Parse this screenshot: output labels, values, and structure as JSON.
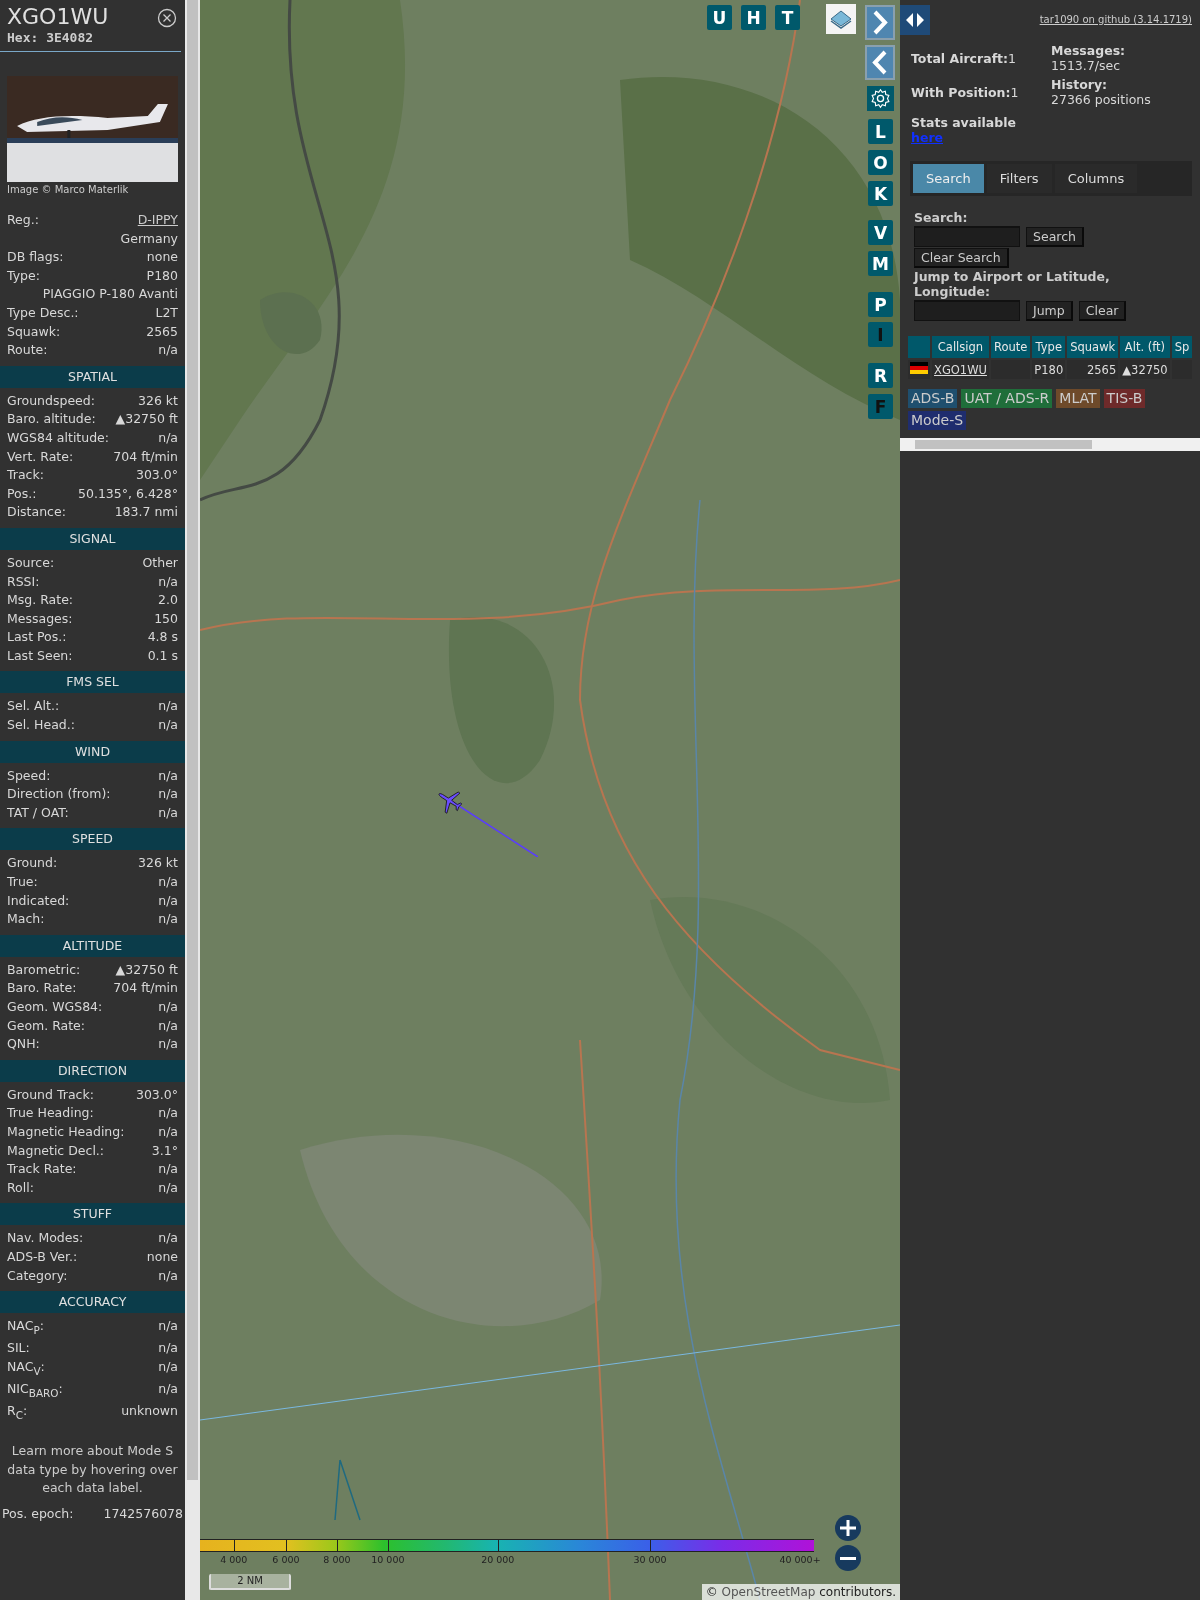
{
  "aircraft": {
    "callsign": "XGO1WU",
    "hex": "Hex: 3E4082",
    "photo_credit": "Image © Marco Materlik"
  },
  "details": [
    {
      "kind": "link",
      "label": "Reg.:",
      "value": "D-IPPY"
    },
    {
      "kind": "value",
      "value": "Germany"
    },
    {
      "kind": "pair",
      "label": "DB flags:",
      "value": "none"
    },
    {
      "kind": "pair",
      "label": "Type:",
      "value": "P180"
    },
    {
      "kind": "value",
      "value": "PIAGGIO P-180 Avanti"
    },
    {
      "kind": "pair",
      "label": "Type Desc.:",
      "value": "L2T"
    },
    {
      "kind": "pair",
      "label": "Squawk:",
      "value": "2565"
    },
    {
      "kind": "pair",
      "label": "Route:",
      "value": "n/a"
    }
  ],
  "sections": [
    {
      "title": "SPATIAL",
      "rows": [
        {
          "label": "Groundspeed:",
          "value": "326 kt"
        },
        {
          "label": "Baro. altitude:",
          "value": "▲32750 ft"
        },
        {
          "label": "WGS84 altitude:",
          "value": "n/a"
        },
        {
          "label": "Vert. Rate:",
          "value": "704 ft/min"
        },
        {
          "label": "Track:",
          "value": "303.0°"
        },
        {
          "label": "Pos.:",
          "value": "50.135°, 6.428°"
        },
        {
          "label": "Distance:",
          "value": "183.7 nmi"
        }
      ]
    },
    {
      "title": "SIGNAL",
      "rows": [
        {
          "label": "Source:",
          "value": "Other"
        },
        {
          "label": "RSSI:",
          "value": "n/a"
        },
        {
          "label": "Msg. Rate:",
          "value": "2.0"
        },
        {
          "label": "Messages:",
          "value": "150"
        },
        {
          "label": "Last Pos.:",
          "value": "4.8 s"
        },
        {
          "label": "Last Seen:",
          "value": "0.1 s"
        }
      ]
    },
    {
      "title": "FMS SEL",
      "rows": [
        {
          "label": "Sel. Alt.:",
          "value": "n/a"
        },
        {
          "label": "Sel. Head.:",
          "value": "n/a"
        }
      ]
    },
    {
      "title": "WIND",
      "rows": [
        {
          "label": "Speed:",
          "value": "n/a"
        },
        {
          "label": "Direction (from):",
          "value": "n/a"
        },
        {
          "label": "TAT / OAT:",
          "value": "n/a"
        }
      ]
    },
    {
      "title": "SPEED",
      "rows": [
        {
          "label": "Ground:",
          "value": "326 kt"
        },
        {
          "label": "True:",
          "value": "n/a"
        },
        {
          "label": "Indicated:",
          "value": "n/a"
        },
        {
          "label": "Mach:",
          "value": "n/a"
        }
      ]
    },
    {
      "title": "ALTITUDE",
      "rows": [
        {
          "label": "Barometric:",
          "value": "▲32750 ft"
        },
        {
          "label": "Baro. Rate:",
          "value": "704 ft/min"
        },
        {
          "label": "Geom. WGS84:",
          "value": "n/a"
        },
        {
          "label": "Geom. Rate:",
          "value": "n/a"
        },
        {
          "label": "QNH:",
          "value": "n/a"
        }
      ]
    },
    {
      "title": "DIRECTION",
      "rows": [
        {
          "label": "Ground Track:",
          "value": "303.0°"
        },
        {
          "label": "True Heading:",
          "value": "n/a"
        },
        {
          "label": "Magnetic Heading:",
          "value": "n/a"
        },
        {
          "label": "Magnetic Decl.:",
          "value": "3.1°"
        },
        {
          "label": "Track Rate:",
          "value": "n/a"
        },
        {
          "label": "Roll:",
          "value": "n/a"
        }
      ]
    },
    {
      "title": "STUFF",
      "rows": [
        {
          "label": "Nav. Modes:",
          "value": "n/a"
        },
        {
          "label": "ADS-B Ver.:",
          "value": "none"
        },
        {
          "label": "Category:",
          "value": "n/a"
        }
      ]
    },
    {
      "title": "ACCURACY",
      "rows": [
        {
          "label": "NAC$_{P}$:",
          "value": "n/a"
        },
        {
          "label": "SIL:",
          "value": "n/a"
        },
        {
          "label": "NAC$_{V}$:",
          "value": "n/a"
        },
        {
          "label": "NIC$_{BARO}$:",
          "value": "n/a"
        },
        {
          "label": "R$_{C}$:",
          "value": "unknown"
        }
      ]
    }
  ],
  "note": "Learn more about Mode S data type by hovering over each data label.",
  "epoch": {
    "label": "Pos. epoch:",
    "value": "1742576078"
  },
  "map": {
    "kind": "picture",
    "top_buttons": [
      {
        "label": "U",
        "active": true
      },
      {
        "label": "H",
        "active": true
      },
      {
        "label": "T",
        "active": true
      }
    ],
    "side_buttons": [
      {
        "label": "L",
        "active": true
      },
      {
        "label": "O",
        "active": true
      },
      {
        "label": "K",
        "active": true
      },
      {
        "label": "V",
        "active": true
      },
      {
        "label": "M",
        "active": true
      },
      {
        "label": "P",
        "active": true
      },
      {
        "label": "I",
        "active": false
      },
      {
        "label": "R",
        "active": true
      },
      {
        "label": "F",
        "active": false
      }
    ],
    "altitude_legend": [
      "4 000",
      "6 000",
      "8 000",
      "10 000",
      "20 000",
      "30 000",
      "40 000+"
    ],
    "scale": "2 NM",
    "attribution_prefix": "©",
    "attribution_link": "OpenStreetMap",
    "attribution_suffix": "contributors."
  },
  "panel": {
    "version_link": "tar1090 on github (3.14.1719)",
    "stats": [
      {
        "label": "Total Aircraft:",
        "value": "1"
      },
      {
        "label": "With Position:",
        "value": "1"
      },
      {
        "label": "Messages:",
        "value": "1513.7/sec"
      },
      {
        "label": "History:",
        "value": "27366 positions"
      }
    ],
    "stats_text": "Stats available",
    "stats_link": "here",
    "tabs": [
      {
        "label": "Search",
        "selected": true
      },
      {
        "label": "Filters",
        "selected": false
      },
      {
        "label": "Columns",
        "selected": false
      }
    ],
    "search_label": "Search:",
    "search_button": "Search",
    "clear_search_button": "Clear Search",
    "jump_label": "Jump to Airport or Latitude, Longitude:",
    "jump_button": "Jump",
    "clear_button": "Clear",
    "table": {
      "columns": [
        "Callsign",
        "Route",
        "Type",
        "Squawk",
        "Alt. (ft)",
        "Sp"
      ],
      "rows": [
        {
          "callsign": "XGO1WU",
          "type": "P180",
          "squawk": "2565",
          "altitude": "▲32750"
        }
      ]
    },
    "sources": [
      {
        "label": "ADS-B",
        "color": "#1f4f6e"
      },
      {
        "label": "UAT / ADS-R",
        "color": "#1f6e3a"
      },
      {
        "label": "MLAT",
        "color": "#6e4a2a"
      },
      {
        "label": "TIS-B",
        "color": "#6e2a2a"
      },
      {
        "label": "Mode-S",
        "color": "#1f2d6e"
      }
    ]
  }
}
